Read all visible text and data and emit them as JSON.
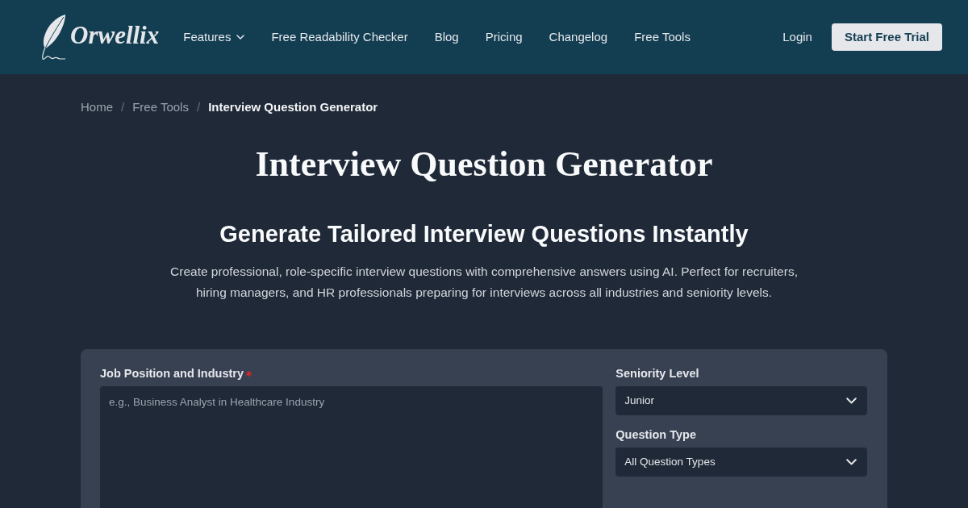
{
  "navbar": {
    "brand": "Orwellix",
    "links": [
      {
        "label": "Features",
        "dropdown": true
      },
      {
        "label": "Free Readability Checker",
        "dropdown": false
      },
      {
        "label": "Blog",
        "dropdown": false
      },
      {
        "label": "Pricing",
        "dropdown": false
      },
      {
        "label": "Changelog",
        "dropdown": false
      },
      {
        "label": "Free Tools",
        "dropdown": false
      }
    ],
    "login": "Login",
    "cta": "Start Free Trial"
  },
  "breadcrumb": {
    "items": [
      {
        "label": "Home",
        "current": false
      },
      {
        "label": "Free Tools",
        "current": false
      },
      {
        "label": "Interview Question Generator",
        "current": true
      }
    ],
    "separators": [
      "/",
      "/"
    ]
  },
  "page_title": "Interview Question Generator",
  "subtitle": "Generate Tailored Interview Questions Instantly",
  "description": "Create professional, role-specific interview questions with comprehensive answers using AI. Perfect for recruiters, hiring managers, and HR professionals preparing for interviews across all industries and seniority levels.",
  "form": {
    "columns": [
      {
        "fields": [
          {
            "kind": "textarea",
            "label": "Job Position and Industry",
            "required": true,
            "placeholder": "e.g., Business Analyst in Healthcare Industry"
          }
        ]
      },
      {
        "fields": [
          {
            "kind": "select",
            "label": "Seniority Level",
            "required": false,
            "value": "Junior"
          },
          {
            "kind": "select",
            "label": "Question Type",
            "required": false,
            "value": "All Question Types"
          }
        ]
      }
    ]
  }
}
